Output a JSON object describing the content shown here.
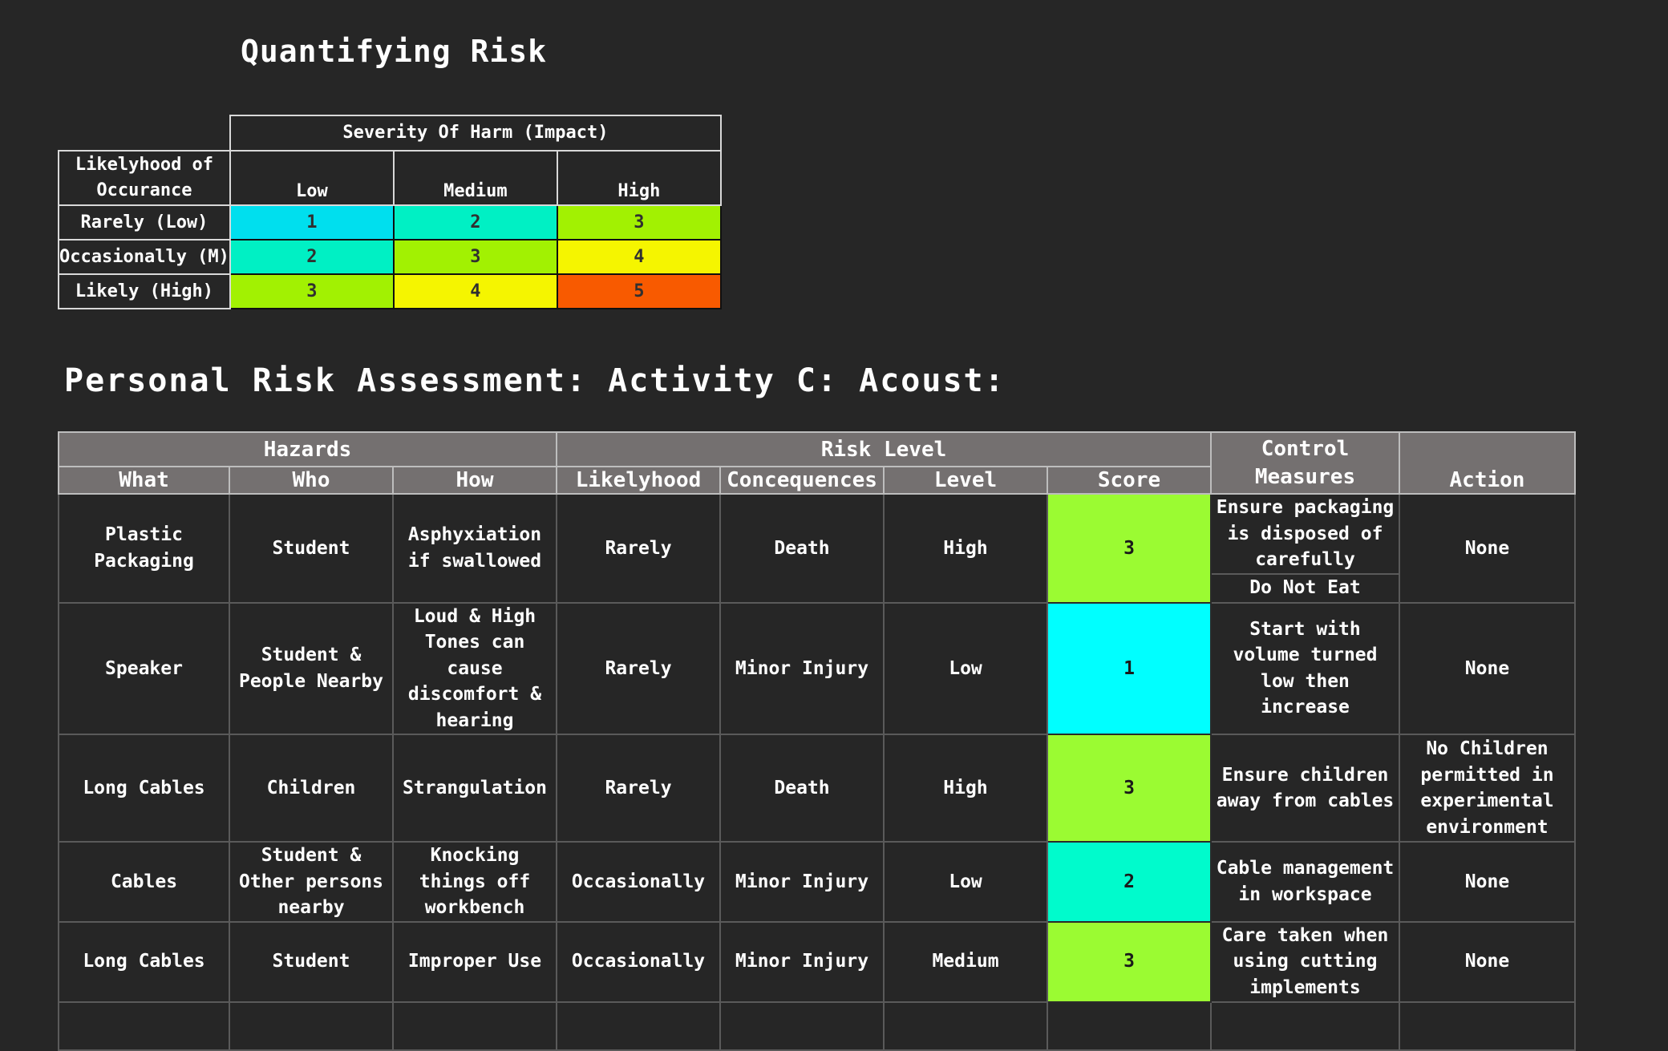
{
  "quantifying": {
    "title": "Quantifying Risk",
    "severity_header": "Severity Of Harm (Impact)",
    "likelyhood_header": "Likelyhood of Occurance",
    "columns": [
      "Low",
      "Medium",
      "High"
    ],
    "rows": [
      {
        "label": "Rarely (Low)",
        "cells": [
          {
            "value": "1",
            "color": "#00dfee"
          },
          {
            "value": "2",
            "color": "#00f0c4"
          },
          {
            "value": "3",
            "color": "#a2f102"
          }
        ]
      },
      {
        "label": "Occasionally (M)",
        "cells": [
          {
            "value": "2",
            "color": "#00f0c4"
          },
          {
            "value": "3",
            "color": "#a2f102"
          },
          {
            "value": "4",
            "color": "#f5f500"
          }
        ]
      },
      {
        "label": "Likely (High)",
        "cells": [
          {
            "value": "3",
            "color": "#a2f102"
          },
          {
            "value": "4",
            "color": "#f5f500"
          },
          {
            "value": "5",
            "color": "#f85a00"
          }
        ]
      }
    ]
  },
  "assessment": {
    "title": "Personal Risk Assessment: Activity C: Acoust:",
    "group_headers": {
      "hazards": "Hazards",
      "risk_level": "Risk Level",
      "control_measures": "Control Measures",
      "action": "Action"
    },
    "sub_headers": {
      "what": "What",
      "who": "Who",
      "how": "How",
      "likelyhood": "Likelyhood",
      "consequences": "Concequences",
      "level": "Level",
      "score": "Score"
    },
    "rows": [
      {
        "what": "Plastic Packaging",
        "who": "Student",
        "how": "Asphyxiation if swallowed",
        "likelyhood": "Rarely",
        "consequences": "Death",
        "level": "High",
        "score": "3",
        "score_color": "#9bfb32",
        "control": "Ensure packaging is disposed of carefully",
        "control_extra": "Do Not Eat",
        "action": "None"
      },
      {
        "what": "Speaker",
        "who": "Student & People Nearby",
        "how": "Loud & High Tones can cause discomfort & hearing",
        "likelyhood": "Rarely",
        "consequences": "Minor Injury",
        "level": "Low",
        "score": "1",
        "score_color": "#00ffff",
        "control": "Start with volume turned low then increase",
        "action": "None"
      },
      {
        "what": "Long Cables",
        "who": "Children",
        "how": "Strangulation",
        "likelyhood": "Rarely",
        "consequences": "Death",
        "level": "High",
        "score": "3",
        "score_color": "#9bfb32",
        "control": "Ensure children away from cables",
        "action": "No Children permitted in experimental environment"
      },
      {
        "what": "Cables",
        "who": "Student & Other persons nearby",
        "how": "Knocking things off workbench",
        "likelyhood": "Occasionally",
        "consequences": "Minor Injury",
        "level": "Low",
        "score": "2",
        "score_color": "#00fbcc",
        "control": "Cable management in workspace",
        "action": "None"
      },
      {
        "what": "Long Cables",
        "who": "Student",
        "how": "Improper Use",
        "likelyhood": "Occasionally",
        "consequences": "Minor Injury",
        "level": "Medium",
        "score": "3",
        "score_color": "#9bfb32",
        "control": "Care taken when using cutting implements",
        "action": "None"
      },
      {
        "what": "",
        "who": "",
        "how": "",
        "likelyhood": "",
        "consequences": "",
        "level": "",
        "score": "",
        "score_color": "",
        "control": "",
        "action": ""
      }
    ]
  }
}
